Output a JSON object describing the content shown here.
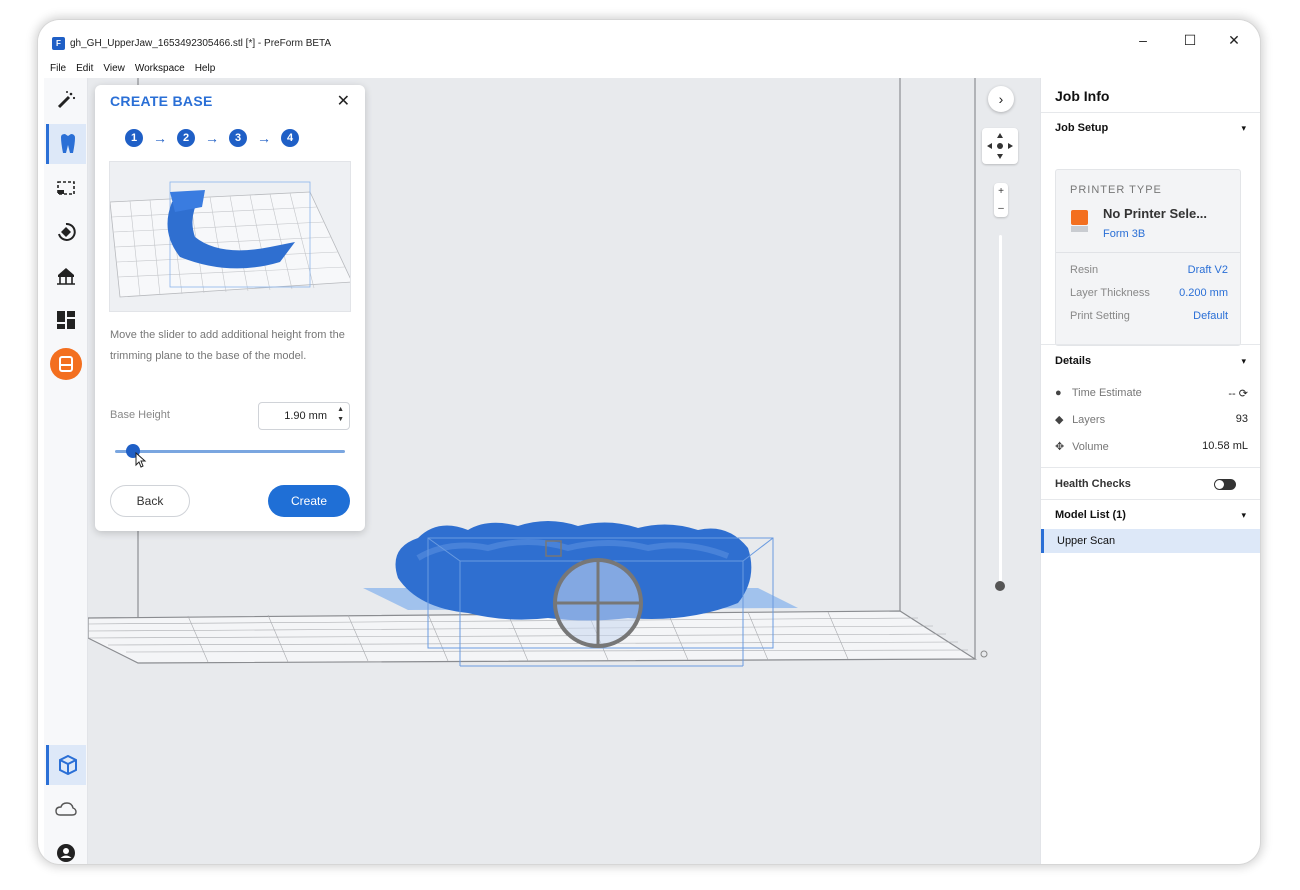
{
  "window": {
    "title": "gh_GH_UpperJaw_1653492305466.stl [*] - PreForm BETA",
    "app_icon": "F",
    "minimize": "–",
    "maximize": "☐",
    "close": "✕"
  },
  "menu": [
    "File",
    "Edit",
    "View",
    "Workspace",
    "Help"
  ],
  "toolbar": {
    "tools": [
      "magic-wand-icon",
      "tooth-icon",
      "select-box-icon",
      "orient-icon",
      "supports-icon",
      "layout-icon",
      "print-icon"
    ],
    "bottom": [
      "model-view-icon",
      "cloud-icon",
      "account-icon"
    ]
  },
  "create_base": {
    "title": "CREATE BASE",
    "close": "✕",
    "steps": [
      "1",
      "2",
      "3",
      "4"
    ],
    "arrow": "→",
    "description": "Move the slider to add additional height from the trimming plane to the base of the model.",
    "base_height_label": "Base Height",
    "base_height_value": "1.90 mm",
    "slider_fraction": 0.08,
    "back_label": "Back",
    "create_label": "Create"
  },
  "viewport_controls": {
    "expand": "›",
    "zoom_in": "+",
    "zoom_out": "–"
  },
  "sidebar": {
    "header": "Job Info",
    "job_setup": "Job Setup",
    "printer_type_label": "PRINTER TYPE",
    "printer_name": "No Printer Sele...",
    "printer_model": "Form 3B",
    "settings": [
      {
        "label": "Resin",
        "value": "Draft V2"
      },
      {
        "label": "Layer Thickness",
        "value": "0.200 mm"
      },
      {
        "label": "Print Setting",
        "value": "Default"
      }
    ],
    "details": "Details",
    "detail_rows": [
      {
        "icon": "clock-icon",
        "label": "Time Estimate",
        "value": "-- ⟳"
      },
      {
        "icon": "layers-icon",
        "label": "Layers",
        "value": "93"
      },
      {
        "icon": "volume-icon",
        "label": "Volume",
        "value": "10.58 mL"
      }
    ],
    "health_checks": "Health Checks",
    "model_list": "Model List (1)",
    "models": [
      "Upper Scan"
    ],
    "chevron": "▾"
  },
  "colors": {
    "accent": "#2a6fd6",
    "orange": "#f36f1f",
    "model_blue": "#2f6fd0",
    "viewport_bg": "#e8eaed"
  }
}
